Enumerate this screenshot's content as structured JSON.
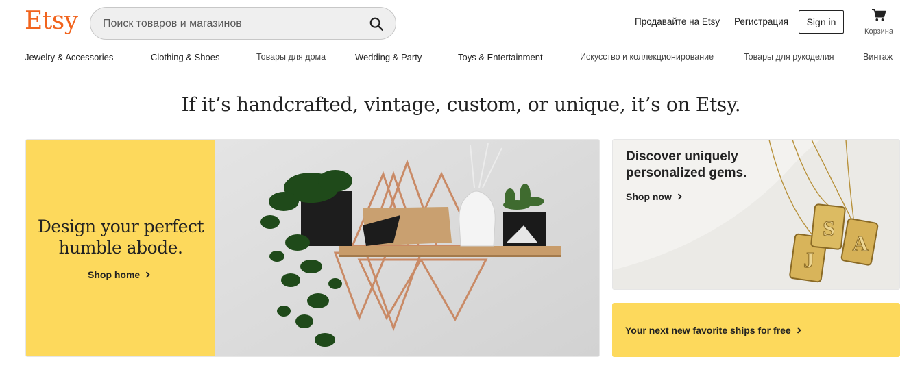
{
  "header": {
    "logo": "Etsy",
    "search": {
      "placeholder": "Поиск товаров и магазинов"
    },
    "links": {
      "sell": "Продавайте на Etsy",
      "register": "Регистрация",
      "signin": "Sign in",
      "cart": "Корзина"
    }
  },
  "categories": [
    "Jewelry & Accessories",
    "Clothing & Shoes",
    "Товары для дома",
    "Wedding & Party",
    "Toys & Entertainment",
    "Искусство и коллекционирование",
    "Товары для рукоделия",
    "Винтаж"
  ],
  "headline": "If it’s handcrafted, vintage, custom, or unique, it’s on Etsy.",
  "hero": {
    "title": "Design your perfect humble abode.",
    "link": "Shop home"
  },
  "gems": {
    "title": "Discover uniquely personalized gems.",
    "link": "Shop now",
    "pendant_letters": [
      "J",
      "S",
      "A"
    ]
  },
  "free": {
    "link": "Your next new favorite ships for free"
  },
  "colors": {
    "brand": "#F1641E",
    "yellow": "#FDD95C"
  },
  "icons": {
    "search": "search-icon",
    "cart": "cart-icon",
    "chevron": "chevron-right-icon"
  }
}
